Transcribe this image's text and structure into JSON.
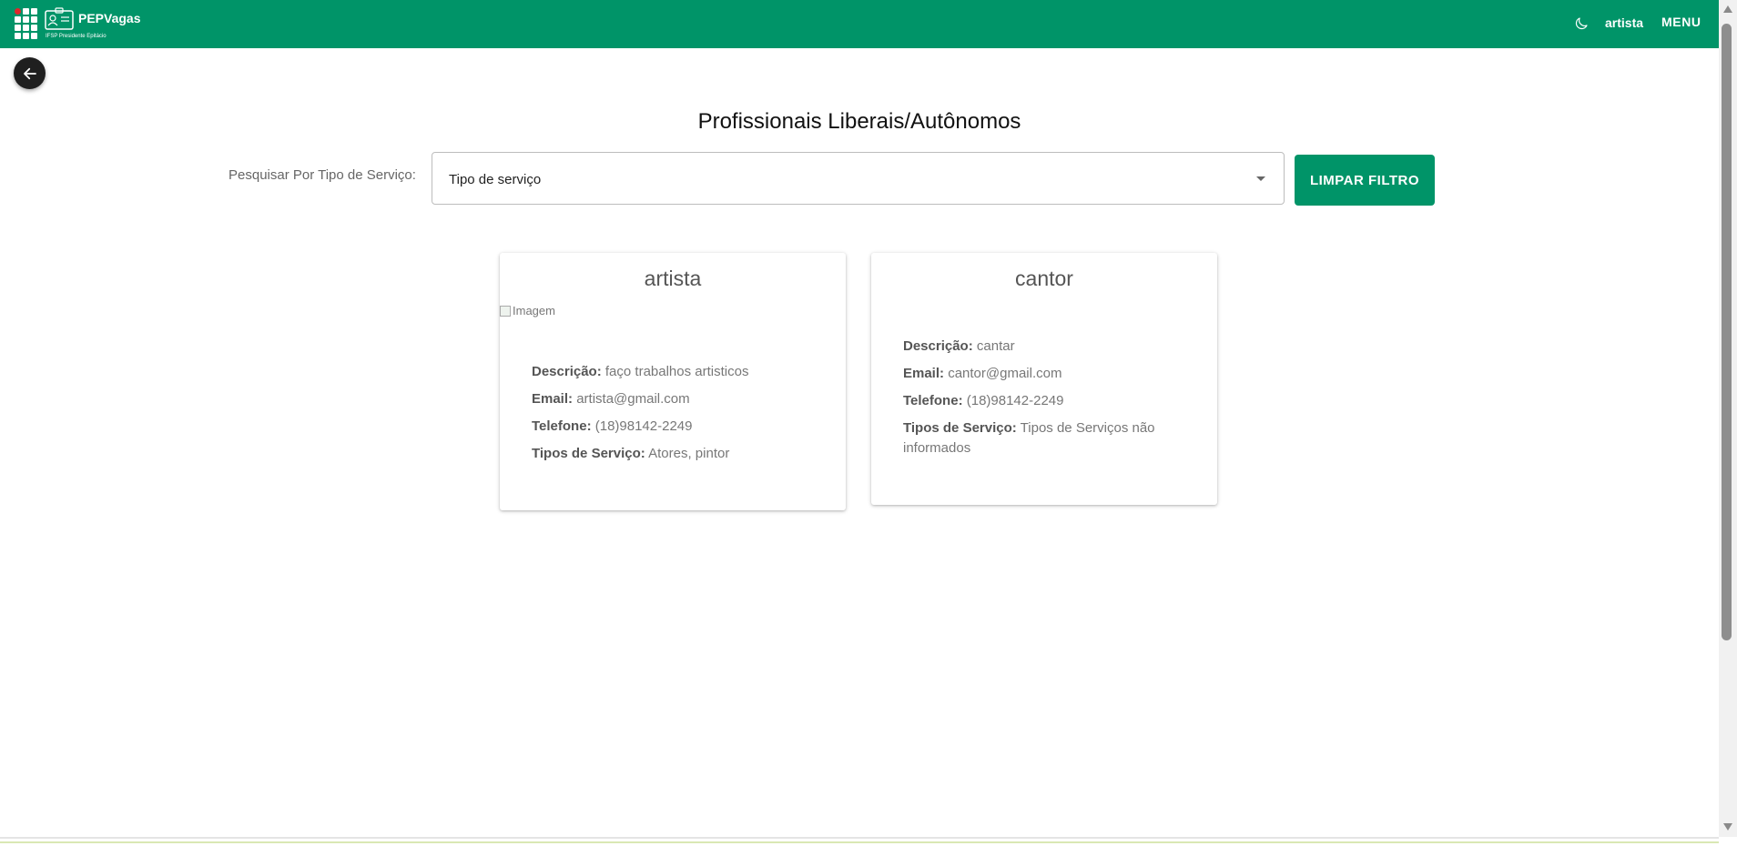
{
  "header": {
    "brand": "PEPVagas",
    "subtitle": "IFSP Presidente Epitácio",
    "user": "artista",
    "menu_label": "MENU",
    "theme_icon": "moon-icon"
  },
  "page": {
    "title": "Profissionais Liberais/Autônomos"
  },
  "filter": {
    "label": "Pesquisar Por Tipo de Serviço:",
    "select_value": "Tipo de serviço",
    "clear_label": "LIMPAR FILTRO"
  },
  "cards": [
    {
      "name": "artista",
      "image_alt": "Imagem",
      "description_label": "Descrição:",
      "description": "faço trabalhos artisticos",
      "email_label": "Email:",
      "email": "artista@gmail.com",
      "phone_label": "Telefone:",
      "phone": "(18)98142-2249",
      "services_label": "Tipos de Serviço:",
      "services": "Atores, pintor"
    },
    {
      "name": "cantor",
      "description_label": "Descrição:",
      "description": "cantar",
      "email_label": "Email:",
      "email": "cantor@gmail.com",
      "phone_label": "Telefone:",
      "phone": "(18)98142-2249",
      "services_label": "Tipos de Serviço:",
      "services": "Tipos de Serviços não informados"
    }
  ],
  "colors": {
    "primary": "#009468",
    "logo_accent": "#e0262c"
  }
}
